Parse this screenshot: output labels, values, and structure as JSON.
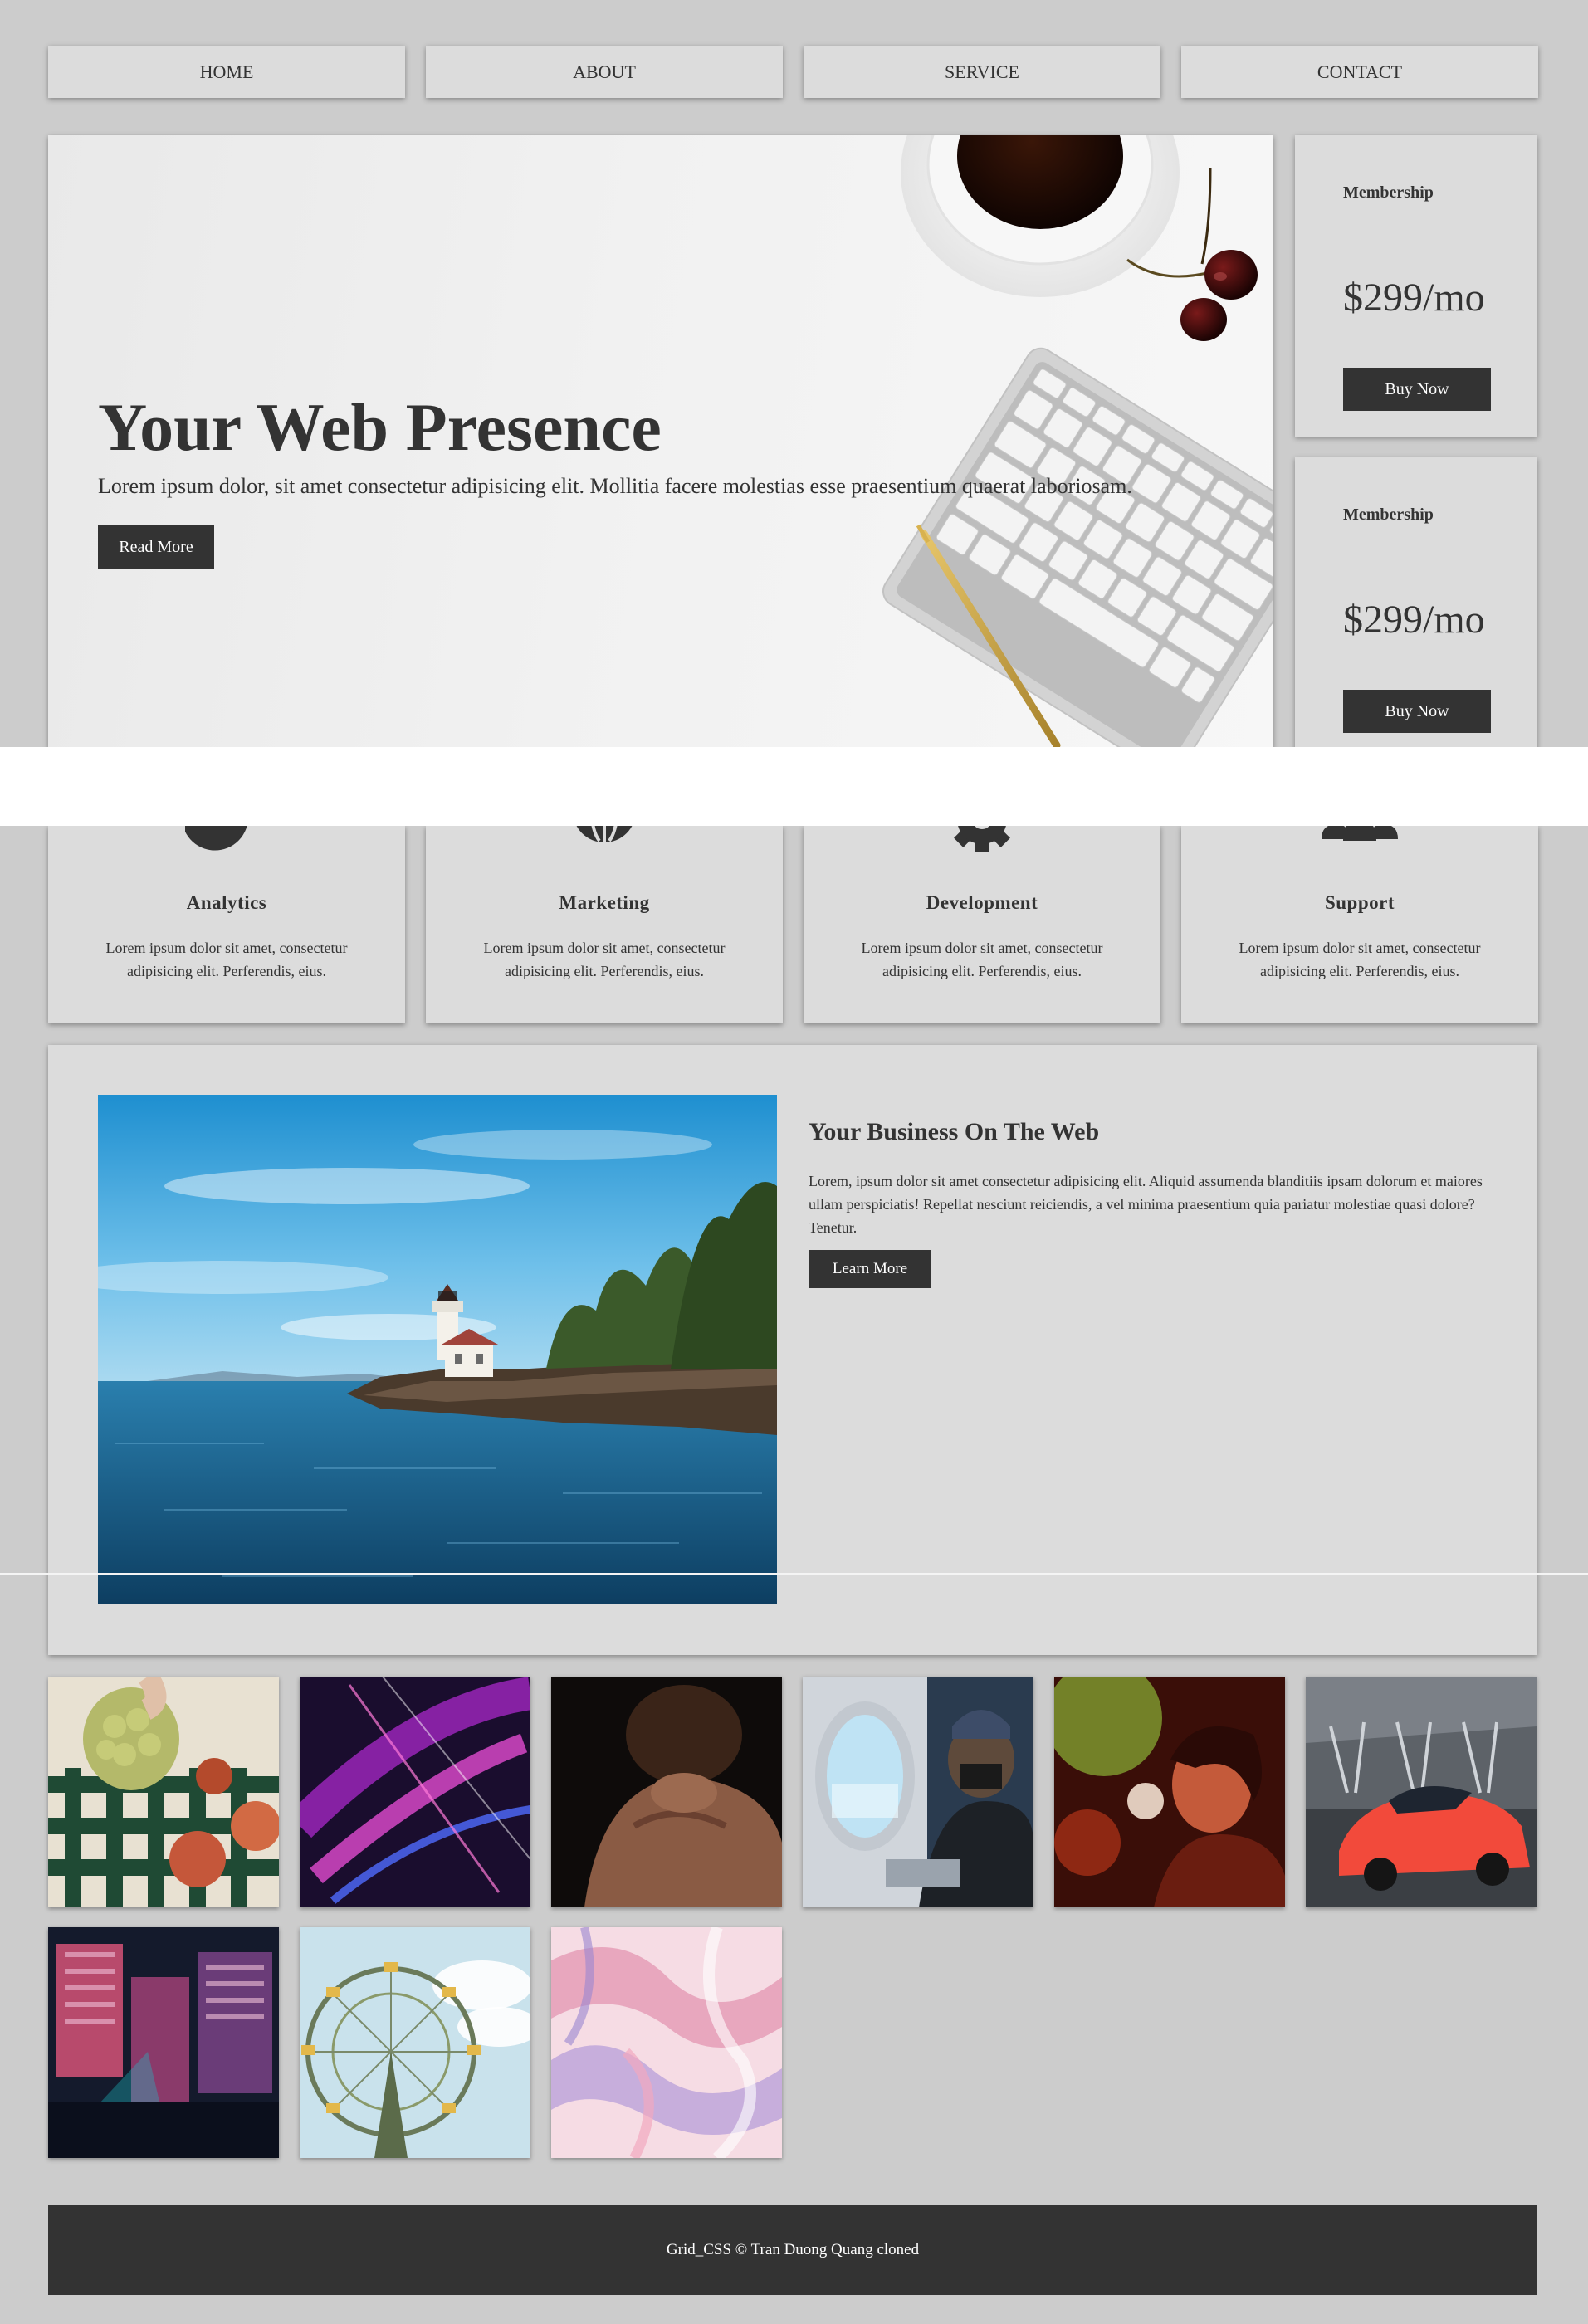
{
  "nav": {
    "items": [
      {
        "label": "HOME"
      },
      {
        "label": "ABOUT"
      },
      {
        "label": "SERVICE"
      },
      {
        "label": "CONTACT"
      }
    ]
  },
  "hero": {
    "title": "Your Web Presence",
    "text": "Lorem ipsum dolor, sit amet consectetur adipisicing elit. Mollitia facere molestias esse praesentium quaerat laboriosam.",
    "button": "Read More"
  },
  "membership": [
    {
      "label": "Membership",
      "price": "$299/mo",
      "button": "Buy Now"
    },
    {
      "label": "Membership",
      "price": "$299/mo",
      "button": "Buy Now"
    }
  ],
  "features": [
    {
      "title": "Analytics",
      "text": "Lorem ipsum dolor sit amet, consectetur adipisicing elit. Perferendis, eius.",
      "icon": "chart-pie-icon"
    },
    {
      "title": "Marketing",
      "text": "Lorem ipsum dolor sit amet, consectetur adipisicing elit. Perferendis, eius.",
      "icon": "globe-icon"
    },
    {
      "title": "Development",
      "text": "Lorem ipsum dolor sit amet, consectetur adipisicing elit. Perferendis, eius.",
      "icon": "cog-icon"
    },
    {
      "title": "Support",
      "text": "Lorem ipsum dolor sit amet, consectetur adipisicing elit. Perferendis, eius.",
      "icon": "users-icon"
    }
  ],
  "business": {
    "title": "Your Business On The Web",
    "text": "Lorem, ipsum dolor sit amet consectetur adipisicing elit. Aliquid assumenda blanditiis ipsam dolorum et maiores ullam perspiciatis! Repellat nesciunt reiciendis, a vel minima praesentium quia pariatur molestiae quasi dolore? Tenetur.",
    "button": "Learn More"
  },
  "footer": {
    "text": "Grid_CSS © Tran Duong Quang cloned"
  },
  "colors": {
    "page_bg": "#cccccc",
    "card_bg": "#dcdcdc",
    "dark": "#333333"
  }
}
